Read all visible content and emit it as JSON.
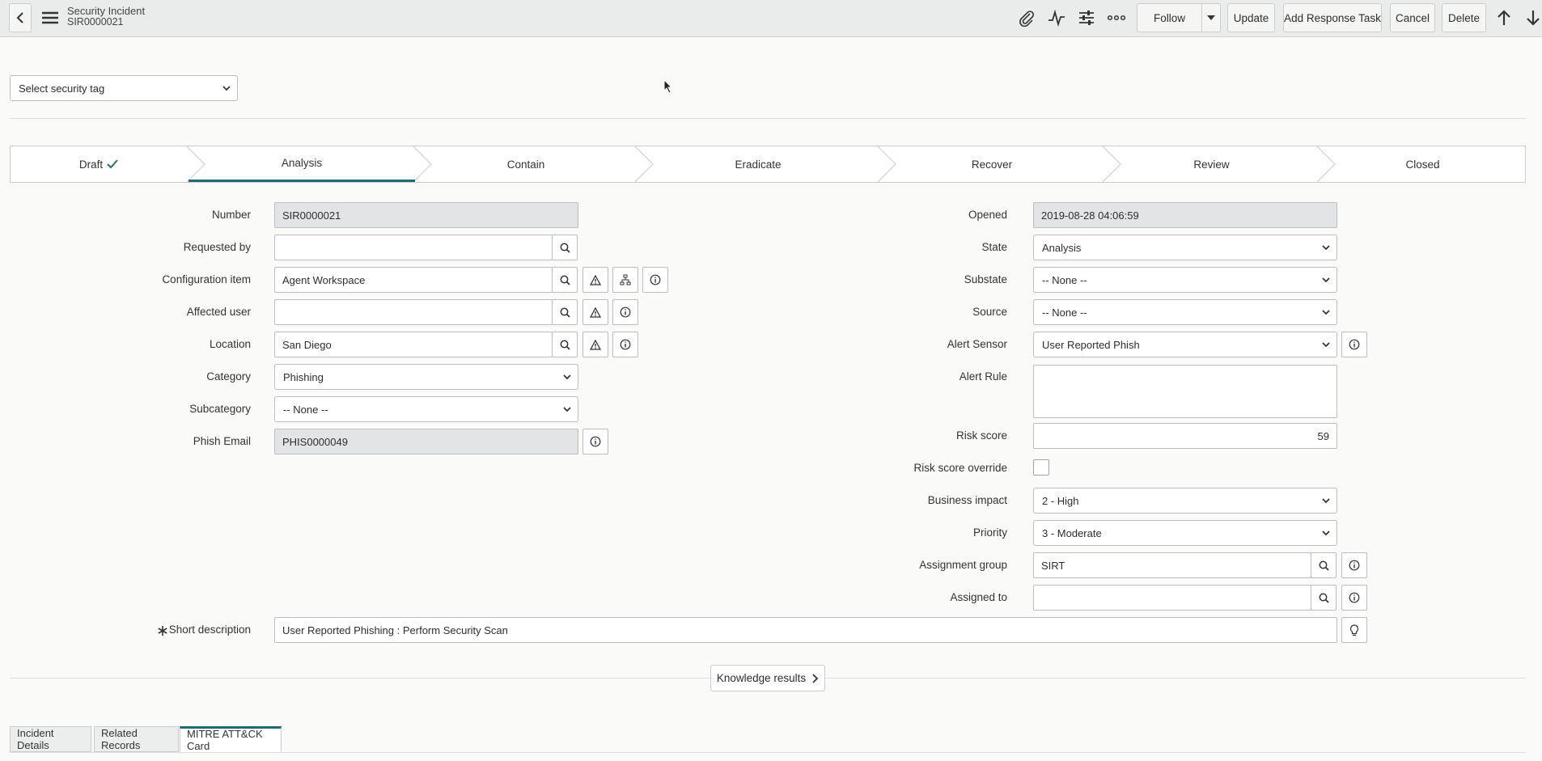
{
  "header": {
    "title": "Security Incident",
    "subtitle": "SIR0000021",
    "follow_label": "Follow",
    "update_label": "Update",
    "add_response_label": "Add Response Task",
    "cancel_label": "Cancel",
    "delete_label": "Delete"
  },
  "security_tag": {
    "value": "Select security tag"
  },
  "stages": [
    "Draft",
    "Analysis",
    "Contain",
    "Eradicate",
    "Recover",
    "Review",
    "Closed"
  ],
  "left_fields": {
    "number": {
      "label": "Number",
      "value": "SIR0000021"
    },
    "requested_by": {
      "label": "Requested by",
      "value": ""
    },
    "configuration_item": {
      "label": "Configuration item",
      "value": "Agent Workspace"
    },
    "affected_user": {
      "label": "Affected user",
      "value": ""
    },
    "location": {
      "label": "Location",
      "value": "San Diego"
    },
    "category": {
      "label": "Category",
      "value": "Phishing"
    },
    "subcategory": {
      "label": "Subcategory",
      "value": "-- None --"
    },
    "phish_email": {
      "label": "Phish Email",
      "value": "PHIS0000049"
    }
  },
  "right_fields": {
    "opened": {
      "label": "Opened",
      "value": "2019-08-28 04:06:59"
    },
    "state": {
      "label": "State",
      "value": "Analysis"
    },
    "substate": {
      "label": "Substate",
      "value": "-- None --"
    },
    "source": {
      "label": "Source",
      "value": "-- None --"
    },
    "alert_sensor": {
      "label": "Alert Sensor",
      "value": "User Reported Phish"
    },
    "alert_rule": {
      "label": "Alert Rule",
      "value": ""
    },
    "risk_score": {
      "label": "Risk score",
      "value": "59"
    },
    "risk_override": {
      "label": "Risk score override"
    },
    "business_impact": {
      "label": "Business impact",
      "value": "2 - High"
    },
    "priority": {
      "label": "Priority",
      "value": "3 - Moderate"
    },
    "assignment_group": {
      "label": "Assignment group",
      "value": "SIRT"
    },
    "assigned_to": {
      "label": "Assigned to",
      "value": ""
    }
  },
  "short_description": {
    "label": "Short description",
    "value": "User Reported Phishing :  Perform Security Scan"
  },
  "knowledge_label": "Knowledge results",
  "tabs": [
    "Incident Details",
    "Related Records",
    "MITRE ATT&CK Card"
  ],
  "colors": {
    "accent": "#1f6b73",
    "header_bg": "#eaeceb"
  },
  "icons": [
    "back-icon",
    "menu-icon",
    "paperclip-icon",
    "activity-icon",
    "settings-sliders-icon",
    "more-icon",
    "arrow-up-icon",
    "arrow-down-icon",
    "search-icon",
    "warning-icon",
    "hierarchy-icon",
    "info-icon",
    "lightbulb-icon",
    "chevron-right-icon",
    "check-icon"
  ]
}
